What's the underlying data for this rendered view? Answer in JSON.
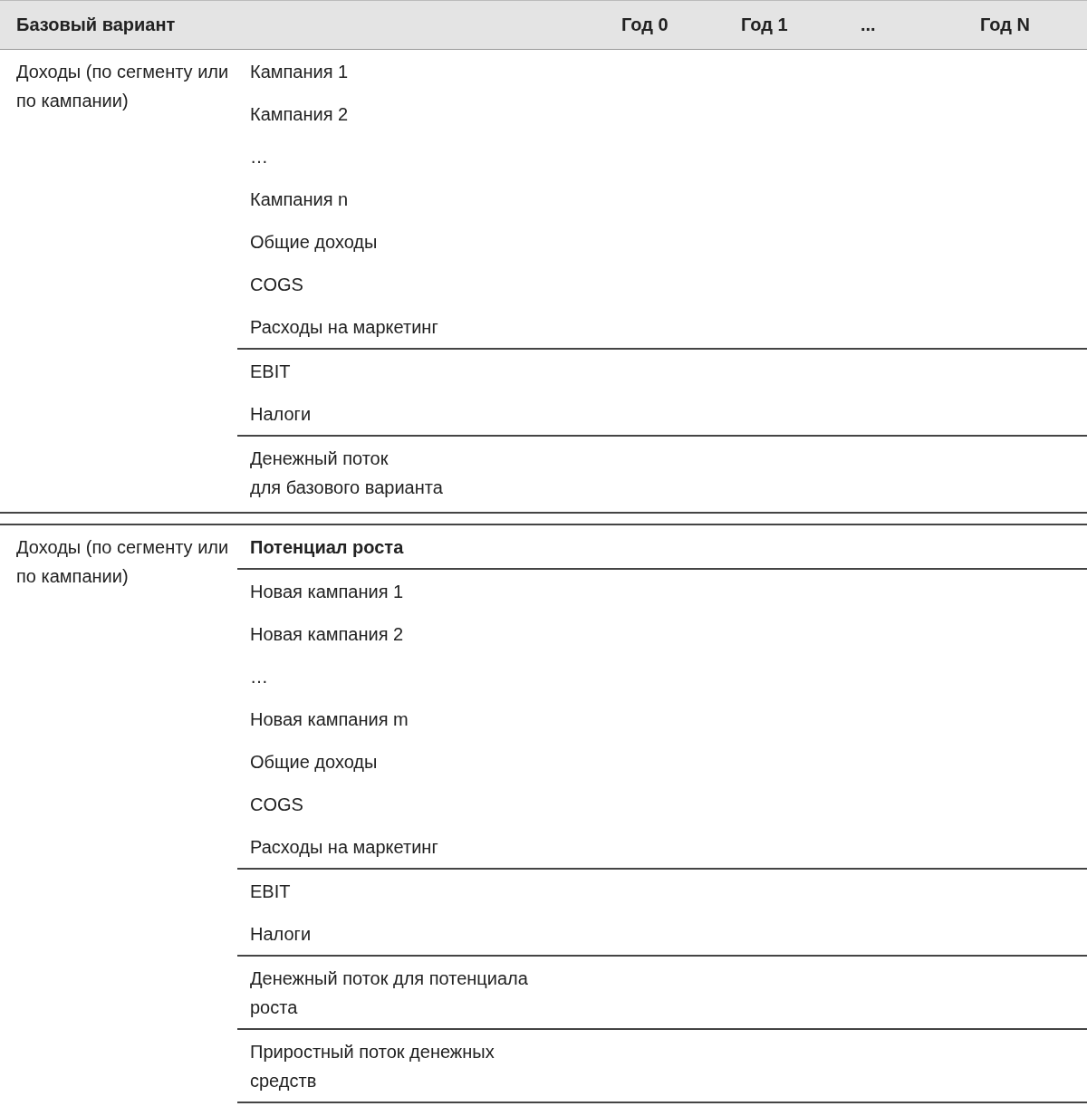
{
  "header": {
    "title": "Базовый вариант",
    "columns": [
      "Год 0",
      "Год 1",
      "...",
      "Год N"
    ]
  },
  "sections": [
    {
      "label": "Доходы (по сегменту или по кампании)",
      "groups": [
        [
          {
            "text": "Кампания 1",
            "kind": "plain"
          },
          {
            "text": "Кампания 2",
            "kind": "plain"
          },
          {
            "text": "…",
            "kind": "plain"
          },
          {
            "text": "Кампания n",
            "kind": "plain"
          },
          {
            "text": "Общие доходы",
            "kind": "plain"
          },
          {
            "text": "COGS",
            "kind": "plain"
          },
          {
            "text": "Расходы на маркетинг",
            "kind": "plain"
          }
        ],
        [
          {
            "text": "EBIT",
            "kind": "plain"
          },
          {
            "text": "Налоги",
            "kind": "plain"
          }
        ],
        [
          {
            "text": "Денежный поток\nдля базового варианта",
            "kind": "plain"
          }
        ]
      ]
    },
    {
      "label": "Доходы (по сегменту или по кампании)",
      "groups": [
        [
          {
            "text": "Потенциал роста",
            "kind": "heading"
          }
        ],
        [
          {
            "text": "Новая кампания 1",
            "kind": "plain"
          },
          {
            "text": "Новая кампания 2",
            "kind": "plain"
          },
          {
            "text": "…",
            "kind": "plain"
          },
          {
            "text": "Новая кампания m",
            "kind": "plain"
          },
          {
            "text": "Общие доходы",
            "kind": "plain"
          },
          {
            "text": "COGS",
            "kind": "plain"
          },
          {
            "text": "Расходы на маркетинг",
            "kind": "plain"
          }
        ],
        [
          {
            "text": "EBIT",
            "kind": "plain"
          },
          {
            "text": "Налоги",
            "kind": "plain"
          }
        ],
        [
          {
            "text": "Денежный поток для потенциала\nроста",
            "kind": "plain"
          }
        ],
        [
          {
            "text": "Приростный поток денежных\nсредств",
            "kind": "plain"
          }
        ]
      ]
    }
  ]
}
